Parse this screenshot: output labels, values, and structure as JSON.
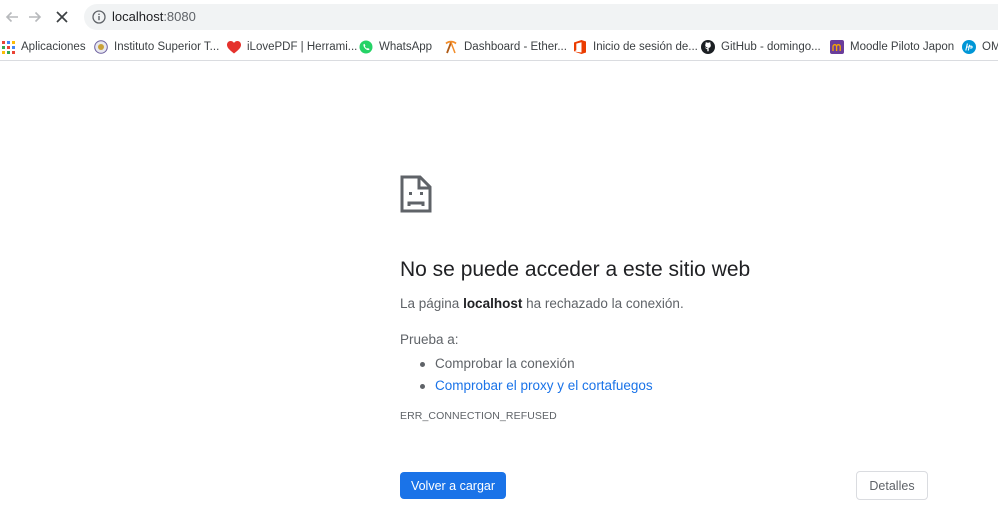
{
  "toolbar": {
    "url_host": "localhost",
    "url_port": ":8080"
  },
  "bookmarks": [
    {
      "label": "Aplicaciones",
      "icon": "apps-grid-icon"
    },
    {
      "label": "Instituto Superior T...",
      "icon": "institute-logo-icon"
    },
    {
      "label": "iLovePDF | Herrami...",
      "icon": "heart-icon"
    },
    {
      "label": "WhatsApp",
      "icon": "whatsapp-icon"
    },
    {
      "label": "Dashboard - Ether...",
      "icon": "pickaxe-icon"
    },
    {
      "label": "Inicio de sesión de...",
      "icon": "office-icon"
    },
    {
      "label": "GitHub - domingo...",
      "icon": "github-icon"
    },
    {
      "label": "Moodle Piloto Japon",
      "icon": "moodle-icon"
    },
    {
      "label": "OM",
      "icon": "hp-icon"
    }
  ],
  "error": {
    "heading": "No se puede acceder a este sitio web",
    "summary_prefix": "La página ",
    "summary_host": "localhost",
    "summary_suffix": " ha rechazado la conexión.",
    "try_label": "Prueba a:",
    "suggestions": [
      "Comprobar la conexión",
      "Comprobar el proxy y el cortafuegos"
    ],
    "code": "ERR_CONNECTION_REFUSED"
  },
  "buttons": {
    "reload": "Volver a cargar",
    "details": "Detalles"
  },
  "colors": {
    "accent": "#1a73e8",
    "muted_text": "#5f6368"
  }
}
